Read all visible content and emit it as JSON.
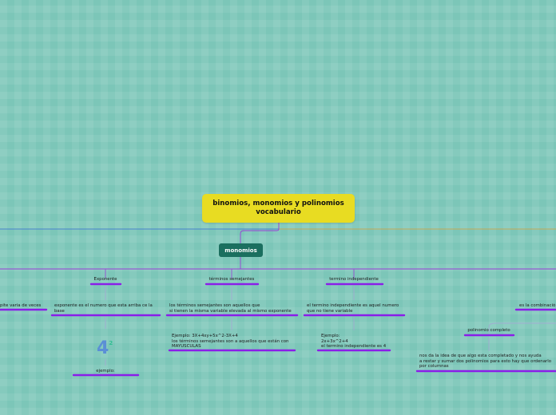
{
  "map": {
    "central_line1": "binomios, monomios y polinomios",
    "central_line2": "vocabulario",
    "main_node": "monomios",
    "branches": {
      "exponente": {
        "title": "Exponente",
        "def_line1": "exponente es el numero que esta arriba ce la",
        "def_line2": "base",
        "example_label": "ejemplo:",
        "example_base": "4",
        "example_exp": "2"
      },
      "semejantes": {
        "title": "términos semejantes",
        "def_line1": "los términos semejantes son aquellos que",
        "def_line2": "si tienen la misma variable elevada al mismo exponente",
        "ex_line1": "Ejemplo: 3X+4xy+5x^2-3X+4",
        "ex_line2": "los términos semejantes son a aquellos que están con",
        "ex_line3": "MAYUSCULAS"
      },
      "independiente": {
        "title": "termino independiente",
        "def_line1": "el termino independiente es aquel numero",
        "def_line2": "que no tiene variable",
        "ex_line1": "Ejemplo:",
        "ex_line2": "2x+3x^2+4",
        "ex_line3": "el termino independiente es 4"
      },
      "left_fragment": "pite varia de veces",
      "right_fragment": "es la combinació",
      "polinomio": {
        "title": "polinomio completo",
        "def_line1": "nos da la idea de que algo esta completado y nos ayuda",
        "def_line2": "a restar y sumar dos polinomios para esto hay que ordenarlo",
        "def_line3": "por columnas"
      }
    }
  },
  "colors": {
    "central": "#e8dc22",
    "main_node": "#1b6f5f",
    "underline": "#8a1ee8",
    "connector_purple": "#9a3fd6",
    "connector_blue": "#3f6fd6",
    "connector_orange": "#e0a23a",
    "connector_light": "#a8a2d8"
  }
}
